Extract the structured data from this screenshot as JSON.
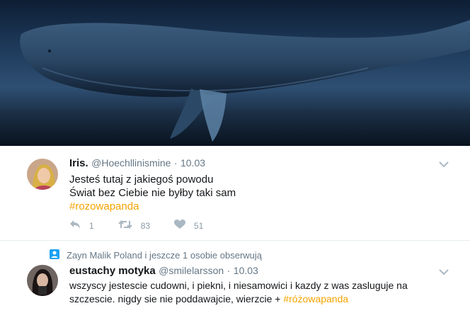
{
  "tweets": [
    {
      "author_name": "Iris.",
      "author_handle": "@Hoechllinismine",
      "separator": "·",
      "date": "10.03",
      "lines": [
        "Jesteś tutaj z jakiegoś powodu",
        "Świat bez Ciebie nie byłby taki sam"
      ],
      "hashtag": "#rozowapanda",
      "replies": "1",
      "retweets": "83",
      "likes": "51"
    },
    {
      "context": "Zayn Malik Poland i jeszcze 1 osobie obserwują",
      "author_name": "eustachy motyka",
      "author_handle": "@smilelarsson",
      "separator": "·",
      "date": "10.03",
      "line1": "wszyscy jestescie cudowni, i piekni, i niesamowici i kazdy z was zasluguje na",
      "line2_prefix": "szczescie. nigdy sie nie poddawajcie, wierzcie + ",
      "hashtag": "#różowapanda"
    }
  ],
  "icons": {
    "reply": "reply-icon",
    "retweet": "retweet-icon",
    "like": "heart-icon",
    "caret": "chevron-down-icon",
    "context": "follow-person-icon"
  },
  "colors": {
    "hashtag": "#f4a300",
    "muted": "#657786",
    "action": "#8899a6"
  }
}
